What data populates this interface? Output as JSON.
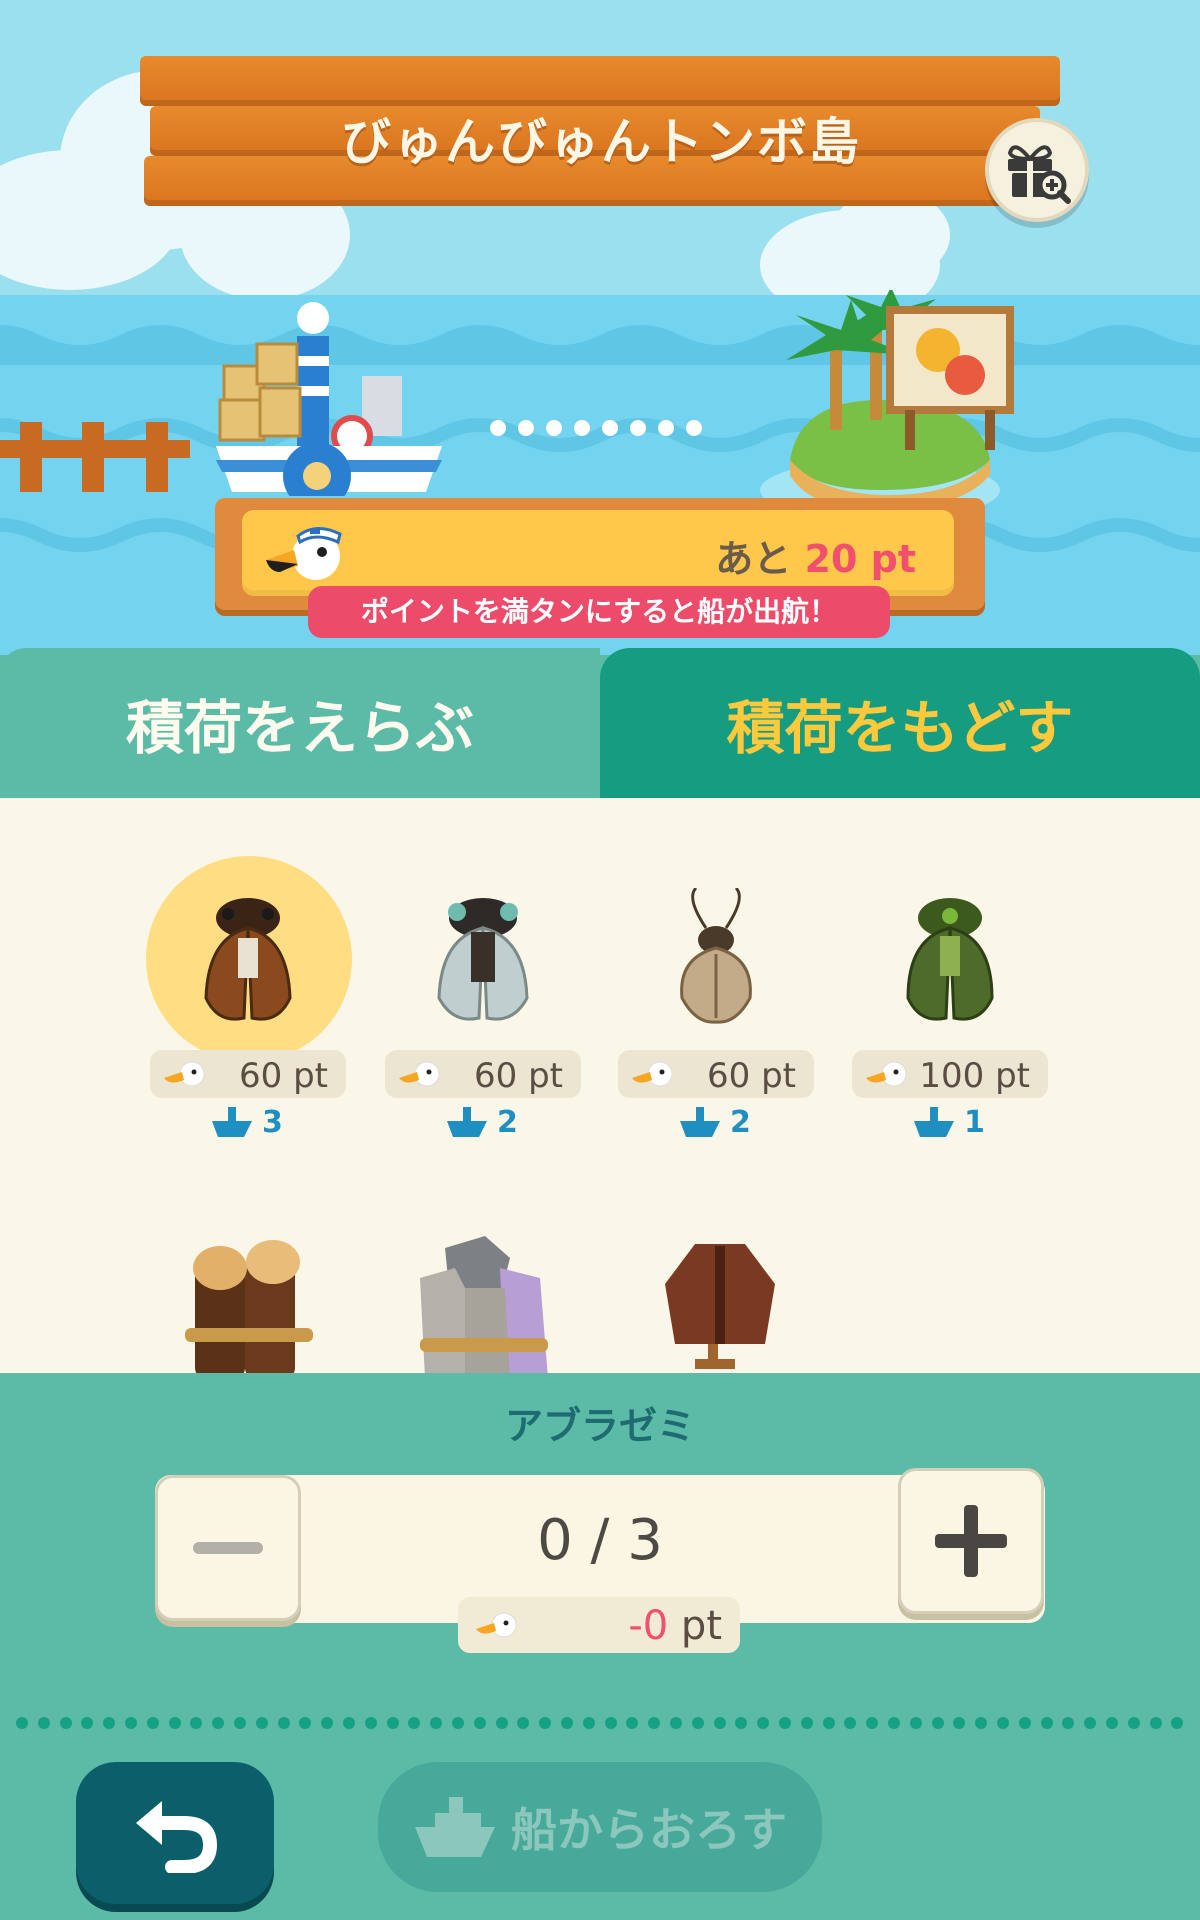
{
  "header": {
    "island_name": "びゅんびゅんトンボ島",
    "gift_icon": "gift-search-icon"
  },
  "progress": {
    "remaining_prefix": "あと",
    "remaining_value": "20",
    "remaining_unit": "pt",
    "hint": "ポイントを満タンにすると船が出航！",
    "fill_fraction": 0.98
  },
  "tabs": [
    {
      "label": "積荷をえらぶ",
      "active": false
    },
    {
      "label": "積荷をもどす",
      "active": true
    }
  ],
  "items": [
    {
      "name": "アブラゼミ",
      "points": "60 pt",
      "stock": "3",
      "selected": true,
      "color": "#8a4a1e"
    },
    {
      "name": "cicada-2",
      "points": "60 pt",
      "stock": "2",
      "selected": false,
      "color": "#7a8a86"
    },
    {
      "name": "cicada-3",
      "points": "60 pt",
      "stock": "2",
      "selected": false,
      "color": "#9a8262"
    },
    {
      "name": "cicada-4",
      "points": "100 pt",
      "stock": "1",
      "selected": false,
      "color": "#4e6b2a"
    }
  ],
  "selection": {
    "name": "アブラゼミ",
    "count": "0 / 3",
    "points_neg": "-0",
    "points_unit": "pt"
  },
  "actions": {
    "back_icon": "undo-arrow-icon",
    "unload_label": "船からおろす"
  },
  "colors": {
    "accent_pink": "#f24e6e",
    "tab_active": "#169c80",
    "tab_active_text": "#ffc93d",
    "panel": "#5bbba6"
  }
}
